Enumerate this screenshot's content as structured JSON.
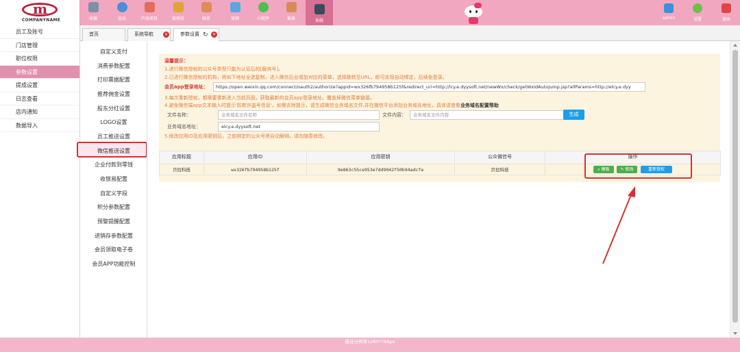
{
  "logo": {
    "text": "COMPANYNAME"
  },
  "topnav": [
    {
      "label": "收银",
      "icon": "cashier-icon",
      "color": "#7f8fa8"
    },
    {
      "label": "会员",
      "icon": "member-icon",
      "color": "#4a8fd6"
    },
    {
      "label": "产品项目",
      "icon": "product-icon",
      "color": "#e26d5c"
    },
    {
      "label": "营销活",
      "icon": "marketing-icon",
      "color": "#e2a23a"
    },
    {
      "label": "财务",
      "icon": "finance-icon",
      "color": "#e08b5a"
    },
    {
      "label": "营销",
      "icon": "promotion-icon",
      "color": "#5aa7e0"
    },
    {
      "label": "小程序",
      "icon": "wechat-icon",
      "color": "#4cbf53"
    },
    {
      "label": "报表",
      "icon": "report-icon",
      "color": "#d88a58"
    },
    {
      "label": "系统",
      "icon": "system-icon",
      "color": "#3a4a5c"
    }
  ],
  "topright": {
    "admin": "admin",
    "settings": "设置",
    "logout": "退出",
    "colors": {
      "admin": "#3d8fd9",
      "settings": "#6bbf4e",
      "logout": "#e04545"
    }
  },
  "leftnav": [
    "员工及账号",
    "门店管理",
    "职位权限",
    "参数设置",
    "提成设置",
    "日志查看",
    "店内通知",
    "数据导入"
  ],
  "tabs": [
    {
      "label": "首页"
    },
    {
      "label": "系统导航"
    },
    {
      "label": "参数设置"
    }
  ],
  "subnav": [
    "自定义支付",
    "消费参数配置",
    "打印票据配置",
    "推荐佣金设置",
    "股东分红设置",
    "LOGO设置",
    "员工推送设置",
    "微信推送设置",
    "企业付款到零钱",
    "收银易配置",
    "自定义字段",
    "积分参数配置",
    "预警提醒配置",
    "进销存参数配置",
    "会员领取电子卷",
    "会员APP功能控制"
  ],
  "tips": {
    "title": "温馨提示：",
    "l1": "1.进行微信授权的公众号类型只能为认证后的[服务号]。",
    "l2": "2.已进行微信授权的机构，将如下地址全选复制，进入微信后台增加对应的菜单，选择跳转至URL，即可实现自动绑定，后续免登录。",
    "url_label": "会员app登录地址：",
    "url_value": "https://open.weixin.qq.com/connect/oauth2/authorize?appid=wx326fb794958b125f&redirect_uri=http://lcy.e.dyysoft.net/newWx/check/getWxIdAutoJump.jsp?allParams=http://elcy.e.dyy",
    "l3": "3.每次重新授权，都需要重新进入当前页面，获取最新的会员app登录地址，覆盖掉微信菜单链接。",
    "l4_pre": "4.避免微信端app文本输入时提示'防欺诈盗号信息'，如需去除提示，请生成微信业务域名文件,并在微信平台添加业务域名地址，具体请查看",
    "l4_link": "业务域名配置帮助",
    "file_name_label": "文件名称：",
    "file_name_ph": "业务域名文件名称",
    "file_content_label": "文件内容：",
    "file_content_ph": "业务域名文件内容",
    "generate": "生成",
    "domain_label": "业务域名地址：",
    "domain_value": "elcy.e.dyysoft.net",
    "l5": "5.修改应用ID及应用密钥后，之前绑定的公众号将自动解绑，请勿随意修改。"
  },
  "table": {
    "headers": [
      "应用标题",
      "应用ID",
      "应用密钥",
      "公众微信号",
      "操作"
    ],
    "row": {
      "title": "贝拉科技",
      "app_id": "wx326fb794958b125f",
      "secret": "9e863c55ce953e7dd9042f50b94adcfe",
      "account": "贝拉科技"
    },
    "actions": {
      "template": "模板",
      "edit": "修改",
      "reauth": "重新授权"
    }
  },
  "footer": "最佳分辨率1280*768px"
}
